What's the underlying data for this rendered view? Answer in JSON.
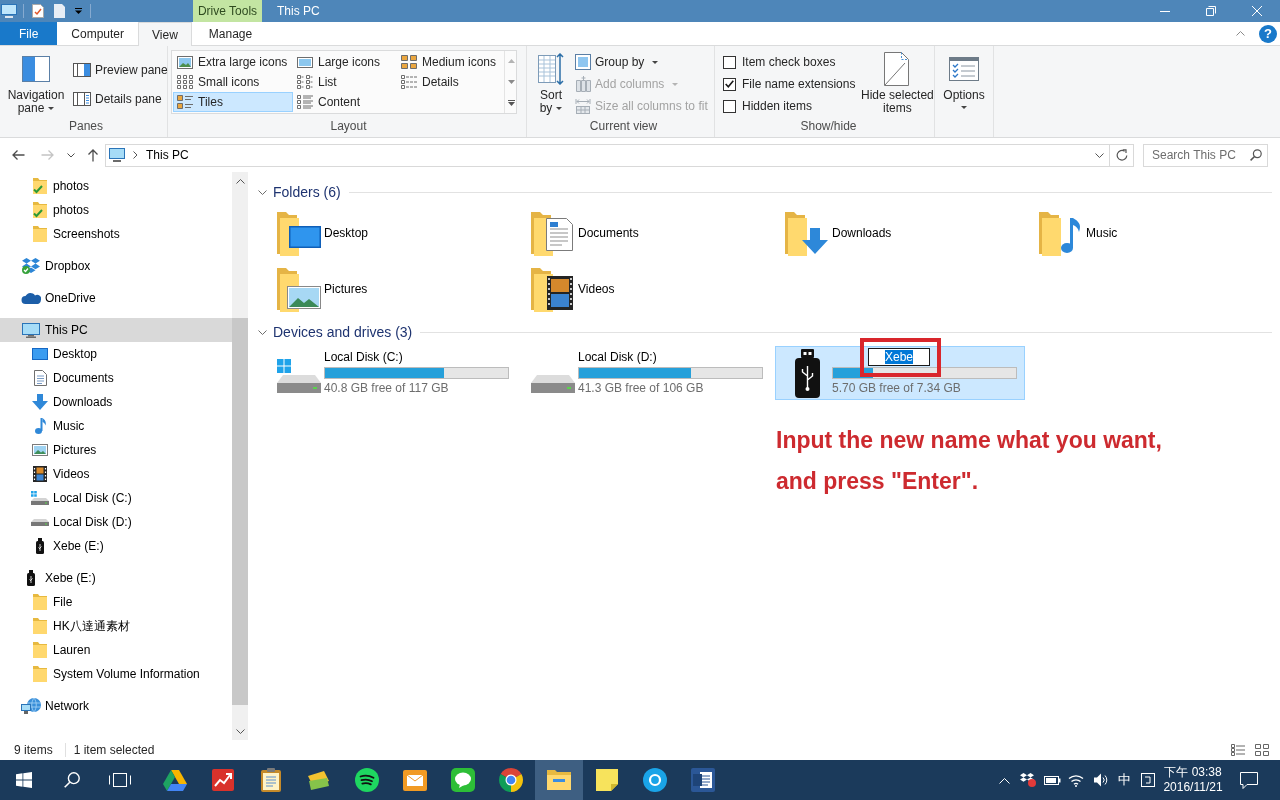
{
  "title_bar": {
    "context_group": "Drive Tools",
    "title": "This PC"
  },
  "ribbon_tabs": [
    {
      "label": "File",
      "kind": "file",
      "selected": false
    },
    {
      "label": "Computer",
      "kind": "tab",
      "selected": false
    },
    {
      "label": "View",
      "kind": "tab",
      "selected": true
    },
    {
      "label": "Manage",
      "kind": "context",
      "selected": false
    }
  ],
  "help": "?",
  "ribbon": {
    "panes": {
      "label": "Panes",
      "navigation_pane": "Navigation pane",
      "buttons": [
        {
          "label": "Preview pane",
          "kind": "preview"
        },
        {
          "label": "Details pane",
          "kind": "details"
        }
      ]
    },
    "layout": {
      "label": "Layout",
      "options": [
        {
          "label": "Extra large icons",
          "kind": "xl",
          "selected": false
        },
        {
          "label": "Large icons",
          "kind": "large",
          "selected": false
        },
        {
          "label": "Medium icons",
          "kind": "medium",
          "selected": false
        },
        {
          "label": "Small icons",
          "kind": "small",
          "selected": false
        },
        {
          "label": "List",
          "kind": "list",
          "selected": false
        },
        {
          "label": "Details",
          "kind": "details",
          "selected": false
        },
        {
          "label": "Tiles",
          "kind": "tiles",
          "selected": true
        },
        {
          "label": "Content",
          "kind": "content",
          "selected": false
        }
      ]
    },
    "current_view": {
      "label": "Current view",
      "sort_by": "Sort by",
      "commands": [
        {
          "label": "Group by",
          "kind": "group",
          "disabled": false,
          "dropdown": true
        },
        {
          "label": "Add columns",
          "kind": "add",
          "disabled": true,
          "dropdown": true
        },
        {
          "label": "Size all columns to fit",
          "kind": "size",
          "disabled": true,
          "dropdown": false
        }
      ]
    },
    "show_hide": {
      "label": "Show/hide",
      "checkboxes": [
        {
          "label": "Item check boxes",
          "checked": false
        },
        {
          "label": "File name extensions",
          "checked": true
        },
        {
          "label": "Hidden items",
          "checked": false
        }
      ],
      "hide_selected": "Hide selected items"
    },
    "options": {
      "label": "Options"
    }
  },
  "address_bar": {
    "nav": [
      {
        "kind": "back",
        "disabled": false
      },
      {
        "kind": "forward",
        "disabled": true
      },
      {
        "kind": "recent",
        "disabled": false
      },
      {
        "kind": "up",
        "disabled": false
      }
    ],
    "path": [
      "This PC"
    ],
    "search_placeholder": "Search This PC"
  },
  "sidebar": {
    "items": [
      {
        "children": [
          {
            "label": "photos",
            "kind": "synced",
            "selected": false
          },
          {
            "label": "photos",
            "kind": "synced",
            "selected": false
          },
          {
            "label": "Screenshots",
            "kind": "folder",
            "selected": false
          }
        ]
      },
      {
        "label": "Dropbox",
        "kind": "dropbox",
        "selected": false
      },
      {
        "label": "OneDrive",
        "kind": "cloud",
        "selected": false
      },
      {
        "label": "This PC",
        "kind": "pc",
        "selected": true,
        "children": [
          {
            "label": "Desktop",
            "kind": "desktop",
            "selected": false
          },
          {
            "label": "Documents",
            "kind": "documents",
            "selected": false
          },
          {
            "label": "Downloads",
            "kind": "downloads",
            "selected": false
          },
          {
            "label": "Music",
            "kind": "music",
            "selected": false
          },
          {
            "label": "Pictures",
            "kind": "pictures",
            "selected": false
          },
          {
            "label": "Videos",
            "kind": "videos",
            "selected": false
          },
          {
            "label": "Local Disk (C:)",
            "kind": "windisk",
            "selected": false
          },
          {
            "label": "Local Disk (D:)",
            "kind": "disk",
            "selected": false
          },
          {
            "label": "Xebe (E:)",
            "kind": "usb",
            "selected": false
          }
        ]
      },
      {
        "label": "Xebe (E:)",
        "kind": "usb",
        "selected": false,
        "children": [
          {
            "label": "File",
            "kind": "folder",
            "selected": false
          },
          {
            "label": "HK八達通素材",
            "kind": "folder",
            "selected": false
          },
          {
            "label": "Lauren",
            "kind": "folder",
            "selected": false
          },
          {
            "label": "System Volume Information",
            "kind": "folder",
            "selected": false
          }
        ]
      },
      {
        "label": "Network",
        "kind": "network",
        "selected": false
      }
    ]
  },
  "content": {
    "groups": [
      {
        "title": "Folders (6)",
        "kind": "folders",
        "expanded": true,
        "items": [
          {
            "label": "Desktop",
            "kind": "desktop",
            "selected": false
          },
          {
            "label": "Documents",
            "kind": "documents",
            "selected": false
          },
          {
            "label": "Downloads",
            "kind": "downloads",
            "selected": false
          },
          {
            "label": "Music",
            "kind": "music",
            "selected": false
          },
          {
            "label": "Pictures",
            "kind": "pictures",
            "selected": false
          },
          {
            "label": "Videos",
            "kind": "videos",
            "selected": false
          }
        ]
      },
      {
        "title": "Devices and drives (3)",
        "kind": "drives",
        "expanded": true,
        "items": [
          {
            "label": "Local Disk (C:)",
            "kind": "windisk",
            "selected": false,
            "level": 0.65,
            "free": "40.8 GB free of 117 GB"
          },
          {
            "label": "Local Disk (D:)",
            "kind": "disk",
            "selected": false,
            "level": 0.61,
            "free": "41.3 GB free of 106 GB"
          },
          {
            "kind": "usb",
            "selected": true,
            "rename": {
              "value": "Xebe",
              "text_selected": true
            },
            "level": 0.22,
            "free": "5.70 GB free of 7.34 GB"
          }
        ]
      }
    ]
  },
  "annotation": "Input the new name what you want, and press \"Enter\".",
  "status_bar": {
    "item_count": "9 items",
    "selection": "1 item selected"
  },
  "taskbar": {
    "apps": [
      {
        "kind": "drive",
        "selected": false
      },
      {
        "kind": "chart",
        "selected": false
      },
      {
        "kind": "clipboard",
        "selected": false
      },
      {
        "kind": "card",
        "selected": false
      },
      {
        "kind": "waves",
        "selected": false
      },
      {
        "kind": "mail",
        "selected": false
      },
      {
        "kind": "chat",
        "selected": false
      },
      {
        "kind": "browser",
        "selected": false
      },
      {
        "kind": "explorer",
        "selected": true
      },
      {
        "kind": "note",
        "selected": false
      },
      {
        "kind": "call",
        "selected": false
      },
      {
        "kind": "word",
        "selected": false
      }
    ],
    "ime": "中",
    "clock": {
      "time": "下午 03:38",
      "date": "2016/11/21"
    }
  }
}
